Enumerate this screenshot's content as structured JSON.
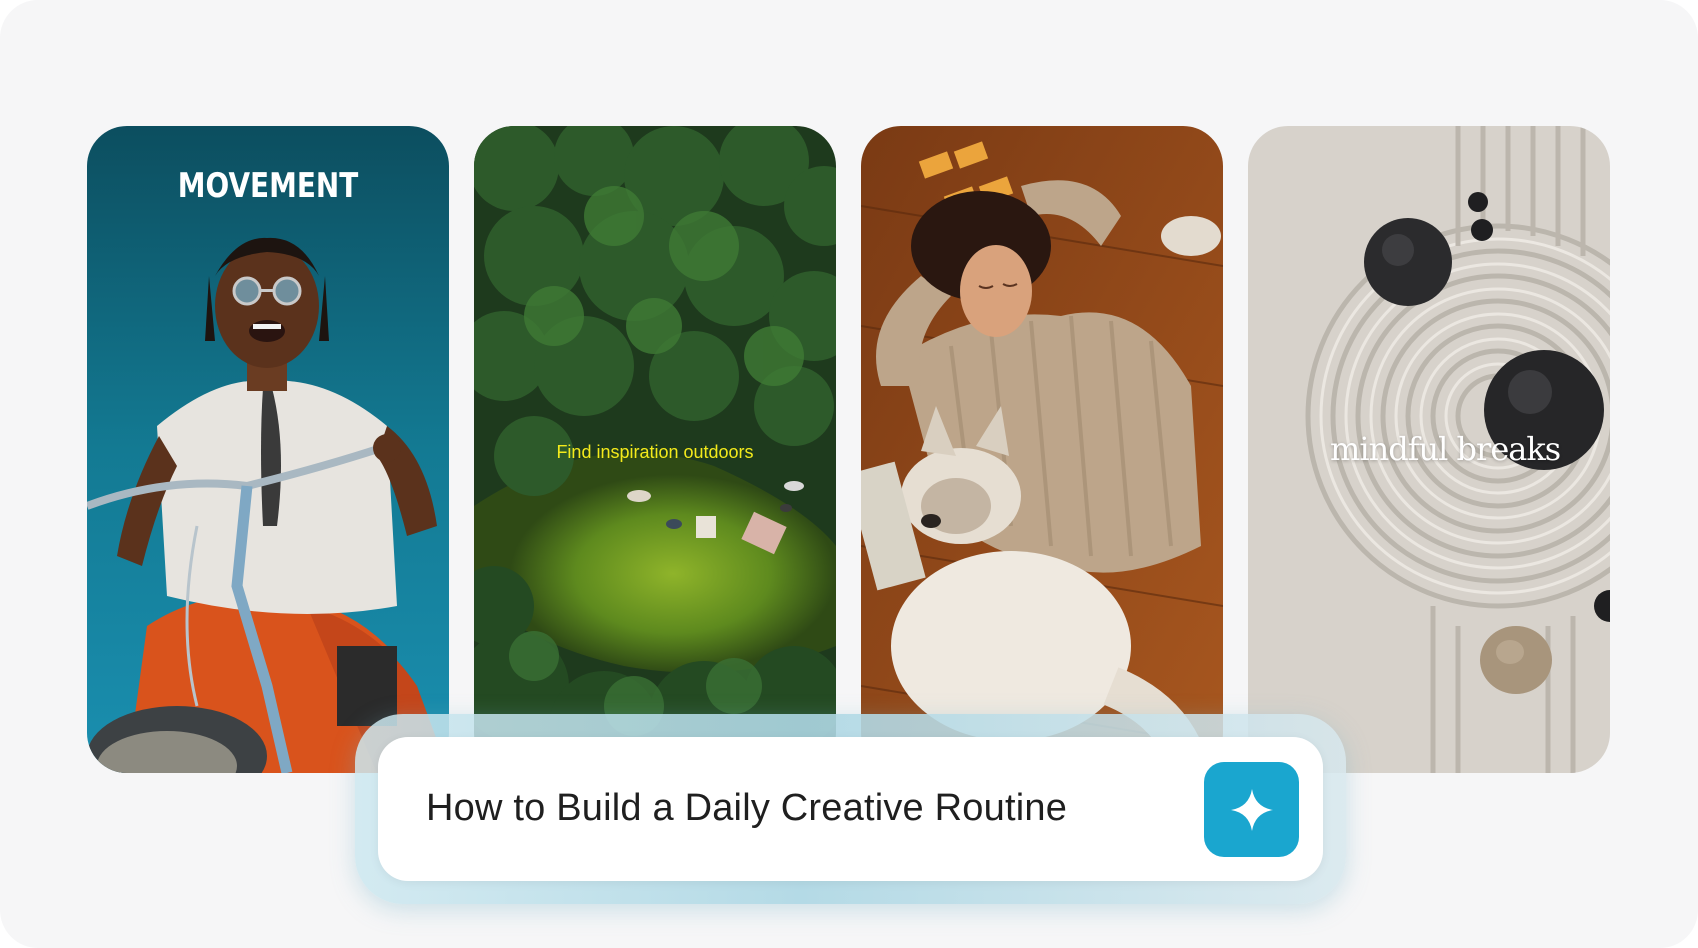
{
  "cards": [
    {
      "label": "MOVEMENT",
      "image": "person laughing on a bicycle against blue sky"
    },
    {
      "label": "Find inspiration outdoors",
      "image": "aerial view of forest clearing with picnickers"
    },
    {
      "label": "",
      "image": "woman resting on wooden floor beside a sleeping dog"
    },
    {
      "label": "mindful breaks",
      "image": "zen sand garden with raked circles and stones"
    }
  ],
  "prompt": {
    "text": "How to Build a Daily Creative Routine",
    "button_icon": "sparkle-icon"
  },
  "colors": {
    "accent": "#1aa6cf",
    "outdoors_label": "#f3ea1b",
    "background": "#f6f6f7"
  }
}
